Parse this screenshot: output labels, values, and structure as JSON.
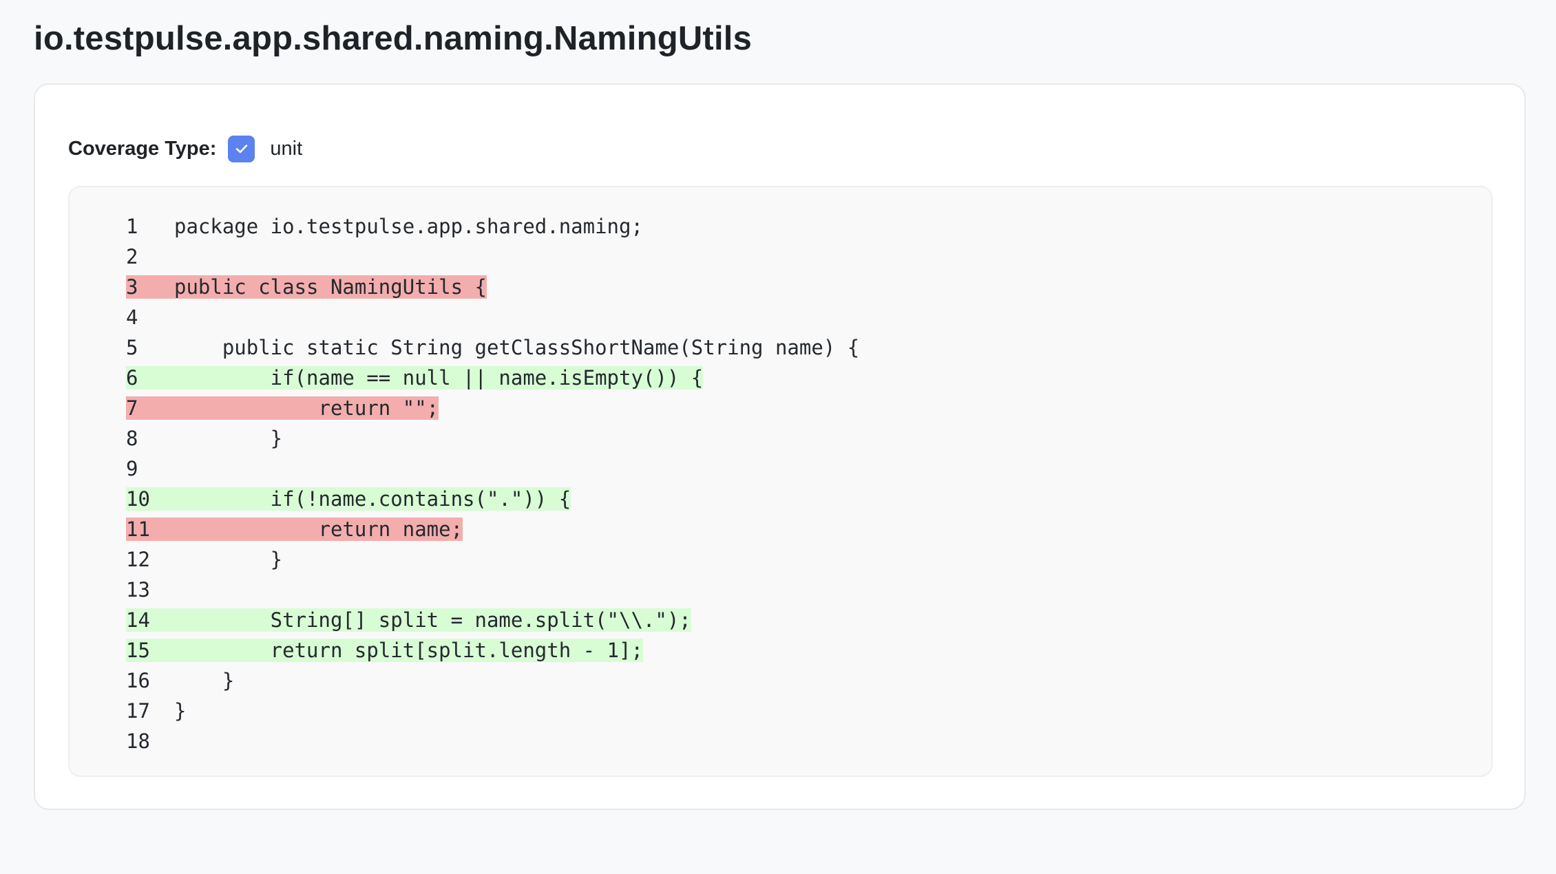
{
  "page": {
    "title": "io.testpulse.app.shared.naming.NamingUtils"
  },
  "filter": {
    "label": "Coverage Type:",
    "options": [
      {
        "label": "unit",
        "checked": true
      }
    ]
  },
  "colors": {
    "covered": "#d8fcd4",
    "missed": "#f3adad",
    "checkbox": "#5b82ee"
  },
  "source": {
    "lines": [
      {
        "number": "1",
        "text": "package io.testpulse.app.shared.naming;",
        "coverage": "none"
      },
      {
        "number": "2",
        "text": "",
        "coverage": "none"
      },
      {
        "number": "3",
        "text": "public class NamingUtils {",
        "coverage": "missed"
      },
      {
        "number": "4",
        "text": "",
        "coverage": "none"
      },
      {
        "number": "5",
        "text": "    public static String getClassShortName(String name) {",
        "coverage": "none"
      },
      {
        "number": "6",
        "text": "        if(name == null || name.isEmpty()) {",
        "coverage": "covered"
      },
      {
        "number": "7",
        "text": "            return \"\";",
        "coverage": "missed"
      },
      {
        "number": "8",
        "text": "        }",
        "coverage": "none"
      },
      {
        "number": "9",
        "text": "",
        "coverage": "none"
      },
      {
        "number": "10",
        "text": "        if(!name.contains(\".\")) {",
        "coverage": "covered"
      },
      {
        "number": "11",
        "text": "            return name;",
        "coverage": "missed"
      },
      {
        "number": "12",
        "text": "        }",
        "coverage": "none"
      },
      {
        "number": "13",
        "text": "",
        "coverage": "none"
      },
      {
        "number": "14",
        "text": "        String[] split = name.split(\"\\\\.\");",
        "coverage": "covered"
      },
      {
        "number": "15",
        "text": "        return split[split.length - 1];",
        "coverage": "covered"
      },
      {
        "number": "16",
        "text": "    }",
        "coverage": "none"
      },
      {
        "number": "17",
        "text": "}",
        "coverage": "none"
      },
      {
        "number": "18",
        "text": "",
        "coverage": "none"
      }
    ]
  }
}
